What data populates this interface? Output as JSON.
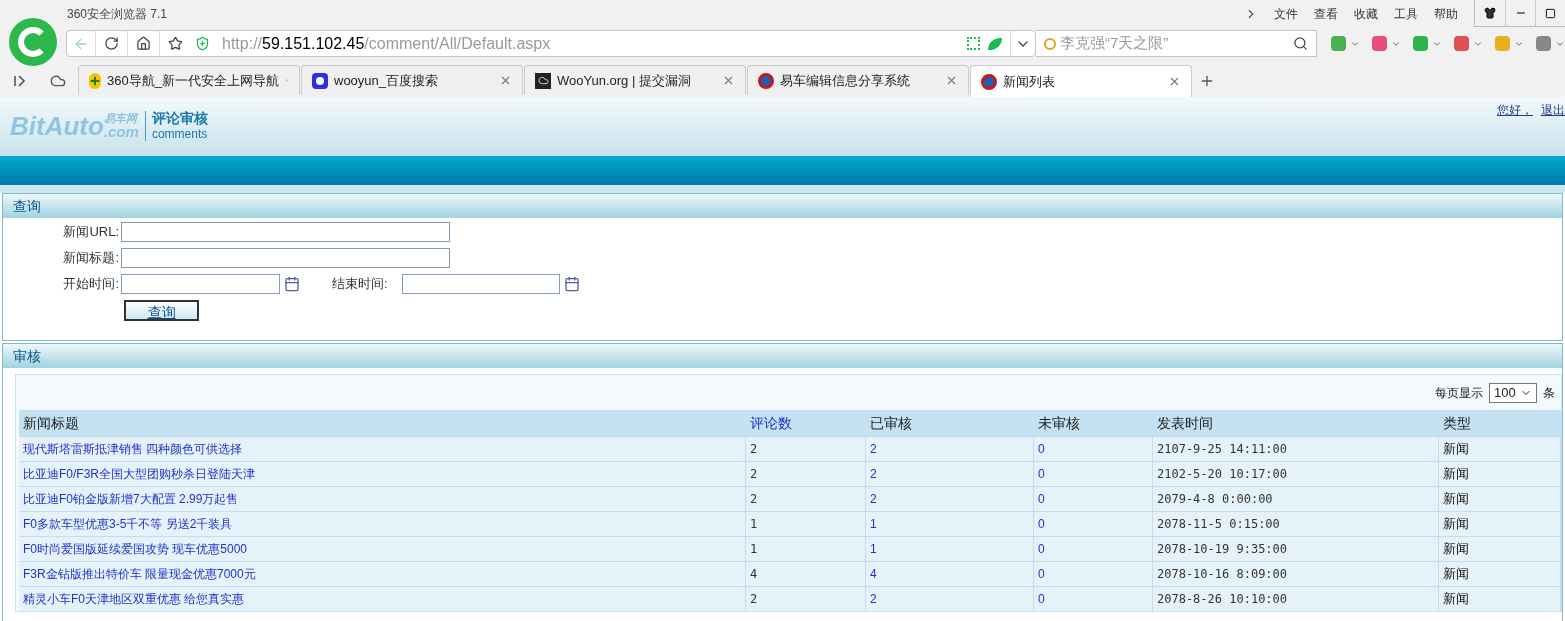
{
  "browser": {
    "title": "360安全浏览器 7.1",
    "menu": [
      "文件",
      "查看",
      "收藏",
      "工具",
      "帮助"
    ],
    "address": {
      "scheme": "http://",
      "host": "59.151.102.45",
      "path": "/comment/All/Default.aspx"
    },
    "search": {
      "placeholder": "李克强“7天之限”"
    },
    "tabs": [
      {
        "label": "360导航_新一代安全上网导航",
        "selected": false
      },
      {
        "label": "wooyun_百度搜索",
        "selected": false
      },
      {
        "label": "WooYun.org | 提交漏洞",
        "selected": false
      },
      {
        "label": "易车编辑信息分享系统",
        "selected": false
      },
      {
        "label": "新闻列表",
        "selected": true
      }
    ]
  },
  "header": {
    "logo": {
      "brand": "BitAuto",
      "cn": "易车网",
      "suffix": ".com"
    },
    "app_title": "评论审核",
    "app_subtitle": "comments",
    "greeting": "您好，",
    "logout": "退出"
  },
  "query": {
    "title": "查询",
    "fields": [
      {
        "label": "新闻URL:"
      },
      {
        "label": "新闻标题:"
      }
    ],
    "start_label": "开始时间:",
    "end_label": "结束时间:",
    "submit": "查询"
  },
  "review": {
    "title": "审核",
    "page_size_label": "每页显示",
    "page_size": "100",
    "page_size_unit": "条",
    "table": {
      "columns": [
        "新闻标题",
        "评论数",
        "已审核",
        "未审核",
        "发表时间",
        "类型"
      ],
      "rows": [
        [
          "现代斯塔雷斯抵津销售 四种颜色可供选择",
          "2",
          "2",
          "0",
          "2107-9-25 14:11:00",
          "新闻"
        ],
        [
          "比亚迪F0/F3R全国大型团购秒杀日登陆天津",
          "2",
          "2",
          "0",
          "2102-5-20 10:17:00",
          "新闻"
        ],
        [
          "比亚迪F0铂金版新增7大配置 2.99万起售",
          "2",
          "2",
          "0",
          "2079-4-8 0:00:00",
          "新闻"
        ],
        [
          "F0多款车型优惠3-5千不等 另送2千装具",
          "1",
          "1",
          "0",
          "2078-11-5 0:15:00",
          "新闻"
        ],
        [
          "F0时尚爱国版延续爱国攻势 现车优惠5000",
          "1",
          "1",
          "0",
          "2078-10-19 9:35:00",
          "新闻"
        ],
        [
          "F3R金钻版推出特价车 限量现金优惠7000元",
          "4",
          "4",
          "0",
          "2078-10-16 8:09:00",
          "新闻"
        ],
        [
          "精灵小车F0天津地区双重优惠 给您真实惠",
          "2",
          "2",
          "0",
          "2078-8-26 10:10:00",
          "新闻"
        ]
      ]
    }
  }
}
